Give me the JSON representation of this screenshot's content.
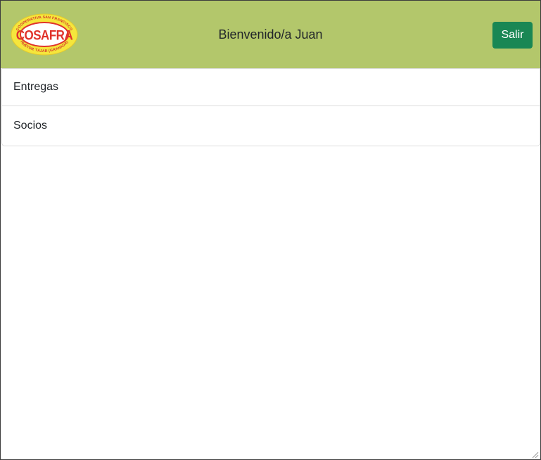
{
  "header": {
    "logo": {
      "icon": "cosafra-logo",
      "text_top": "COOPERATIVA SAN FRANCISCO",
      "text_main": "COSAFRA",
      "text_bottom": "HUÉTOR TÁJAR (GRANADA)",
      "colors": {
        "background": "#f5e63c",
        "accent": "#e0332b"
      }
    },
    "welcome_text": "Bienvenido/a Juan",
    "logout_label": "Salir",
    "colors": {
      "bar": "#b3c76b",
      "logout_button": "#198754"
    }
  },
  "menu": {
    "items": [
      {
        "label": "Entregas"
      },
      {
        "label": "Socios"
      }
    ]
  }
}
